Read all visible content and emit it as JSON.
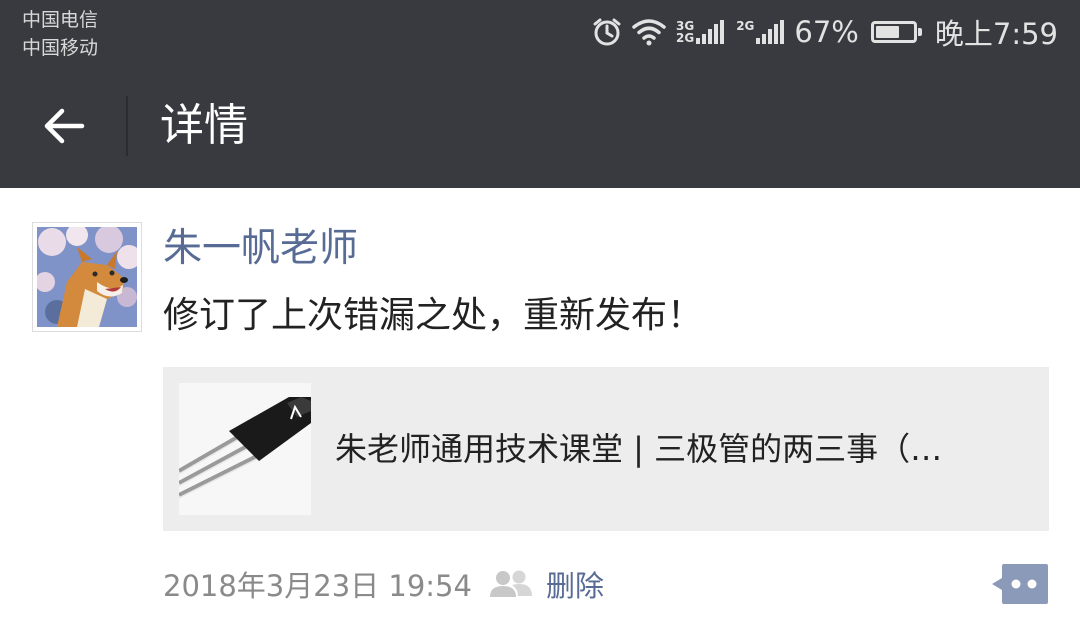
{
  "statusbar": {
    "carrier1": "中国电信",
    "carrier2": "中国移动",
    "net1_top": "3G",
    "net1_bottom": "2G",
    "net2": "2G",
    "battery_text": "67%",
    "battery_level": 0.67,
    "time": "晚上7:59",
    "icons": [
      "alarm-icon",
      "wifi-icon",
      "signal-icon",
      "battery-icon"
    ]
  },
  "navbar": {
    "title": "详情",
    "back_icon": "arrow-left-icon"
  },
  "post": {
    "author": "朱一帆老师",
    "text": "修订了上次错漏之处，重新发布！",
    "link": {
      "title": "朱老师通用技术课堂 | 三极管的两三事（…"
    },
    "timestamp": "2018年3月23日 19:54",
    "visibility_icon": "people-icon",
    "delete_label": "删除",
    "comment_icon": "comment-icon"
  },
  "colors": {
    "header_bg": "#393a3f",
    "link_blue": "#576b95",
    "card_bg": "#ededed"
  }
}
